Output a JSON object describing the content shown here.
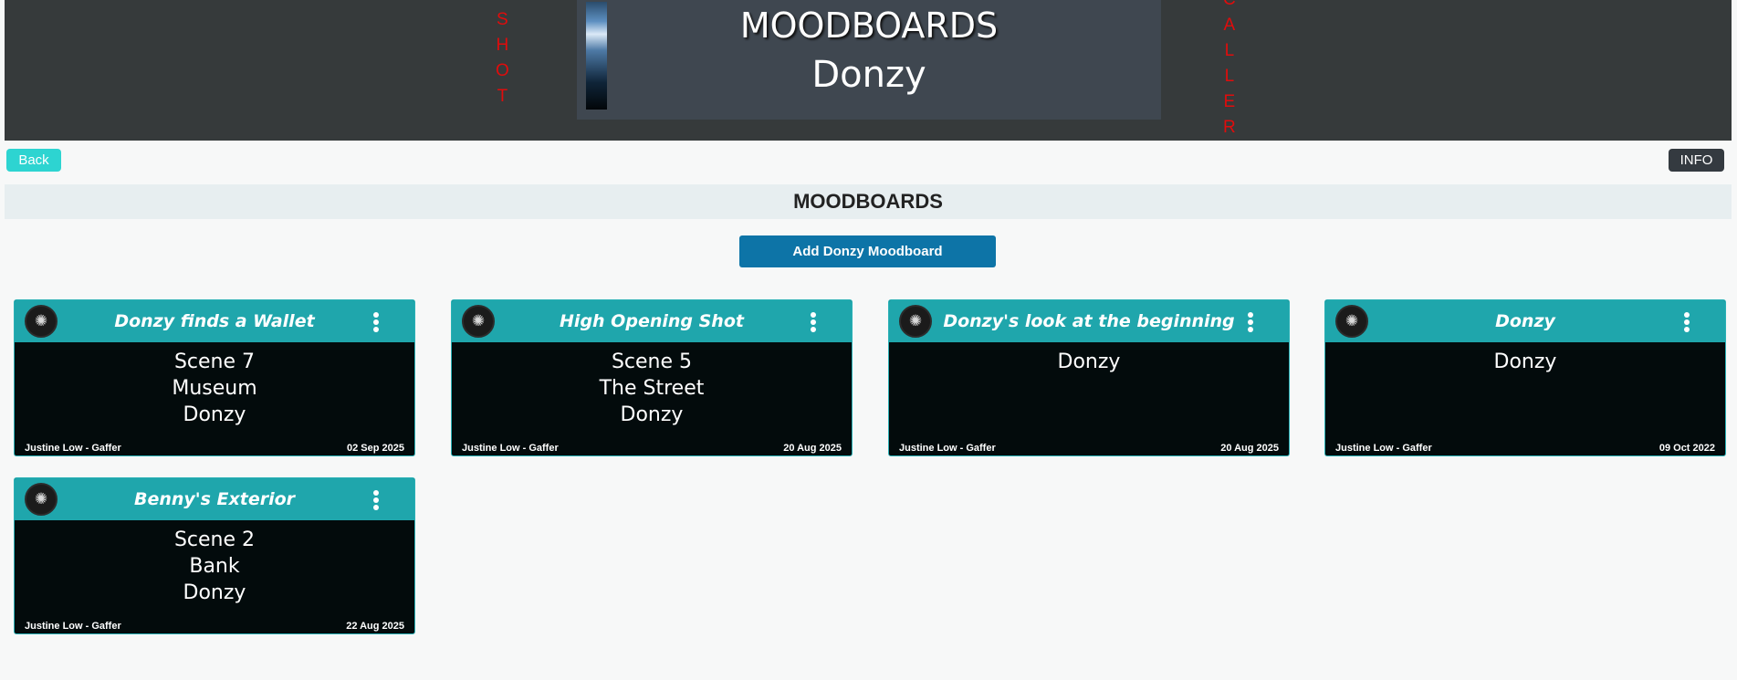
{
  "header": {
    "left_vertical": [
      "S",
      "H",
      "O",
      "T"
    ],
    "right_vertical": [
      "C",
      "A",
      "L",
      "L",
      "E",
      "R"
    ],
    "title": "MOODBOARDS",
    "subtitle": "Donzy",
    "accent_color": "#e00c0c"
  },
  "toolbar": {
    "back_label": "Back",
    "info_label": "INFO"
  },
  "section": {
    "title": "MOODBOARDS",
    "add_button_label": "Add Donzy Moodboard"
  },
  "cards": [
    {
      "title": "Donzy finds a Wallet",
      "lines": [
        "Scene 7",
        "Museum",
        "Donzy"
      ],
      "author": "Justine Low - Gaffer",
      "date": "02 Sep 2025"
    },
    {
      "title": "High Opening Shot",
      "lines": [
        "Scene 5",
        "The Street",
        "Donzy"
      ],
      "author": "Justine Low - Gaffer",
      "date": "20 Aug 2025"
    },
    {
      "title": "Donzy's look at the beginning",
      "lines": [
        "Donzy"
      ],
      "author": "Justine Low - Gaffer",
      "date": "20 Aug 2025"
    },
    {
      "title": "Donzy",
      "lines": [
        "Donzy"
      ],
      "author": "Justine Low - Gaffer",
      "date": "09 Oct 2022"
    },
    {
      "title": "Benny's Exterior",
      "lines": [
        "Scene 2",
        "Bank",
        "Donzy"
      ],
      "author": "Justine Low - Gaffer",
      "date": "22 Aug 2025"
    }
  ]
}
